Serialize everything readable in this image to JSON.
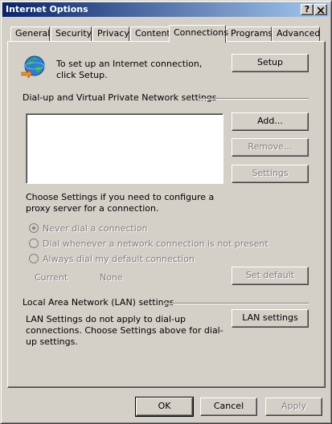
{
  "window": {
    "title": "Internet Options",
    "help_label": "?",
    "close_label": "X"
  },
  "tabs": [
    {
      "label": "General"
    },
    {
      "label": "Security"
    },
    {
      "label": "Privacy"
    },
    {
      "label": "Content"
    },
    {
      "label": "Connections",
      "active": true
    },
    {
      "label": "Programs"
    },
    {
      "label": "Advanced"
    }
  ],
  "connections": {
    "setup_text": "To set up an Internet connection, click Setup.",
    "setup_button": "Setup",
    "dialup_group_label": "Dial-up and Virtual Private Network settings",
    "add_button": "Add...",
    "remove_button": "Remove...",
    "settings_button": "Settings",
    "proxy_text": "Choose Settings if you need to configure a proxy server for a connection.",
    "radios": [
      {
        "label": "Never dial a connection",
        "checked": true,
        "enabled": false
      },
      {
        "label": "Dial whenever a network connection is not present",
        "checked": false,
        "enabled": false
      },
      {
        "label": "Always dial my default connection",
        "checked": false,
        "enabled": false
      }
    ],
    "current_label": "Current",
    "current_value": "None",
    "set_default_button": "Set default",
    "lan_group_label": "Local Area Network (LAN) settings",
    "lan_text": "LAN Settings do not apply to dial-up connections. Choose Settings above for dial-up settings.",
    "lan_settings_button": "LAN settings"
  },
  "footer": {
    "ok_button": "OK",
    "cancel_button": "Cancel",
    "apply_button": "Apply"
  },
  "colors": {
    "face": "#d4d0c8",
    "title_start": "#0a246a",
    "title_end": "#a6caf0",
    "disabled_text": "#808080"
  }
}
